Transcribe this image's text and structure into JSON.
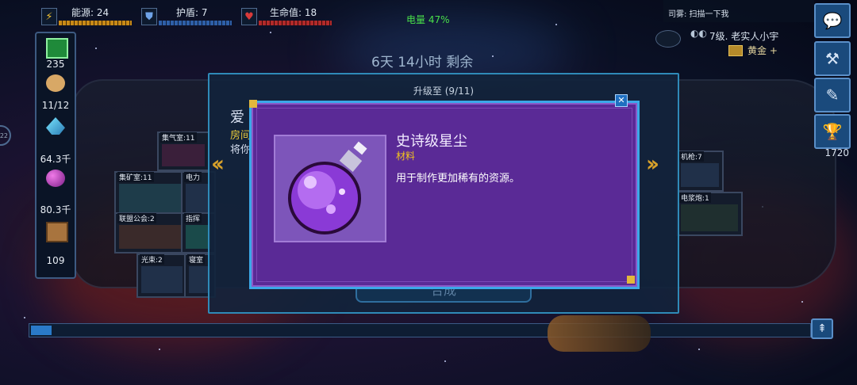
{
  "hud": {
    "energy_label": "能源: 24",
    "shield_label": "护盾: 7",
    "hp_label": "生命值: 18",
    "battery": "电量 47%",
    "time_left": "6天 14小时 剩余"
  },
  "top_right": {
    "fog_text": "司雾: 扫描一下我",
    "player": "7级. 老实人小宇",
    "rank": "黄金 +",
    "trophies": "1720"
  },
  "resources": [
    {
      "icon": "cash-icon",
      "value": "235"
    },
    {
      "icon": "crew-bread-icon",
      "value": "11/12"
    },
    {
      "icon": "mineral-crystal-icon",
      "value": "64.3千"
    },
    {
      "icon": "gas-orb-icon",
      "value": "80.3千"
    },
    {
      "icon": "supply-crate-icon",
      "value": "109"
    }
  ],
  "rooms": [
    {
      "label": "集气室:11"
    },
    {
      "label": "集矿室:11"
    },
    {
      "label": "电力"
    },
    {
      "label": "联盟公会:2"
    },
    {
      "label": "指挥"
    },
    {
      "label": "光束:2"
    },
    {
      "label": "寝室"
    },
    {
      "label": "机枪:7"
    },
    {
      "label": "电浆炮:1"
    }
  ],
  "background_text": {
    "love": "爱",
    "room": "房间",
    "will": "将你",
    "merge": "合成"
  },
  "dialog": {
    "title": "升级至 (9/11)",
    "item_name": "史诗级星尘",
    "item_type": "材料",
    "item_desc": "用于制作更加稀有的资源。",
    "close_glyph": "✕"
  },
  "colors": {
    "card_bg": "#5a2a96",
    "card_border": "#3ba8e8",
    "type_color": "#f3c51c",
    "battery_color": "#49e04a"
  }
}
